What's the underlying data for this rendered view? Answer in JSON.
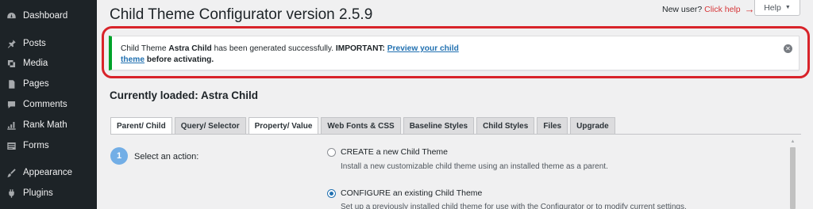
{
  "sidebar": {
    "items": [
      {
        "label": "Dashboard",
        "icon": "dashboard-icon"
      },
      {
        "label": "Posts",
        "icon": "pin-icon"
      },
      {
        "label": "Media",
        "icon": "media-icon"
      },
      {
        "label": "Pages",
        "icon": "pages-icon"
      },
      {
        "label": "Comments",
        "icon": "comment-icon"
      },
      {
        "label": "Rank Math",
        "icon": "chart-icon"
      },
      {
        "label": "Forms",
        "icon": "forms-icon"
      },
      {
        "label": "Appearance",
        "icon": "brush-icon"
      },
      {
        "label": "Plugins",
        "icon": "plugin-icon"
      }
    ]
  },
  "header": {
    "title": "Child Theme Configurator version 2.5.9",
    "new_user": "New user?",
    "click_help": "Click help",
    "help_button": "Help"
  },
  "notice": {
    "part1": "Child Theme ",
    "theme_name": "Astra Child",
    "part2": " has been generated successfully. ",
    "important": "IMPORTANT: ",
    "link1": "Preview your child",
    "link2": "theme",
    "part3": " before activating."
  },
  "section_title": "Currently loaded: Astra Child",
  "tabs": [
    "Parent/ Child",
    "Query/ Selector",
    "Property/ Value",
    "Web Fonts & CSS",
    "Baseline Styles",
    "Child Styles",
    "Files",
    "Upgrade"
  ],
  "step": {
    "number": "1",
    "label": "Select an action:"
  },
  "options": [
    {
      "label": "CREATE a new Child Theme",
      "desc": "Install a new customizable child theme using an installed theme as a parent.",
      "checked": false
    },
    {
      "label": "CONFIGURE an existing Child Theme",
      "desc": "Set up a previously installed child theme for use with the Configurator or to modify current settings.",
      "checked": true
    }
  ],
  "colors": {
    "sidebar_bg": "#1d2327",
    "notice_border": "#00a32a",
    "highlight": "#d8232a",
    "link": "#2271b1",
    "help_link": "#d63638"
  }
}
